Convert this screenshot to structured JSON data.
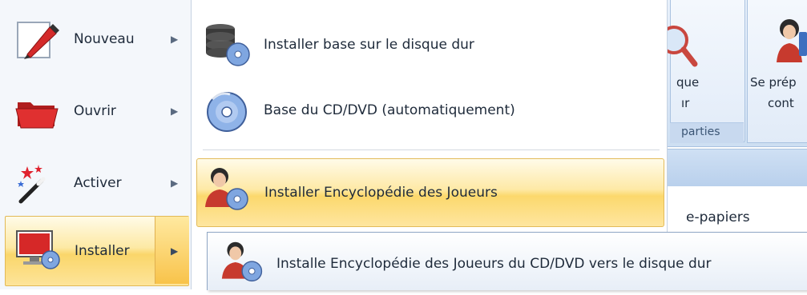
{
  "left_menu": {
    "items": [
      {
        "label": "Nouveau",
        "icon": "pencil-icon"
      },
      {
        "label": "Ouvrir",
        "icon": "folder-icon"
      },
      {
        "label": "Activer",
        "icon": "magic-wand-icon"
      },
      {
        "label": "Installer",
        "icon": "computer-disc-icon",
        "active": true
      }
    ],
    "arrow_glyph": "▶"
  },
  "submenu": {
    "items": [
      {
        "label": "Installer base sur le disque dur",
        "icon": "database-disc-icon"
      },
      {
        "label": "Base du CD/DVD (automatiquement)",
        "icon": "dvd-icon"
      },
      {
        "label": "Installer Encyclopédie des Joueurs",
        "icon": "player-disc-icon",
        "highlighted": true
      }
    ]
  },
  "tooltip": {
    "text": "Installe Encyclopédie des Joueurs du CD/DVD vers le disque dur",
    "icon": "player-disc-icon"
  },
  "ribbon_fragments": {
    "btn1_line1": "que",
    "btn1_line2": "ır",
    "btn2_line1": "Se prép",
    "btn2_line2": "cont",
    "group_label": "parties",
    "doc_text": "e-papiers"
  },
  "colors": {
    "highlight": "#fcd86c",
    "highlight_border": "#e3bb5a",
    "ribbon": "#dce8f7",
    "text": "#1e2a3a"
  }
}
